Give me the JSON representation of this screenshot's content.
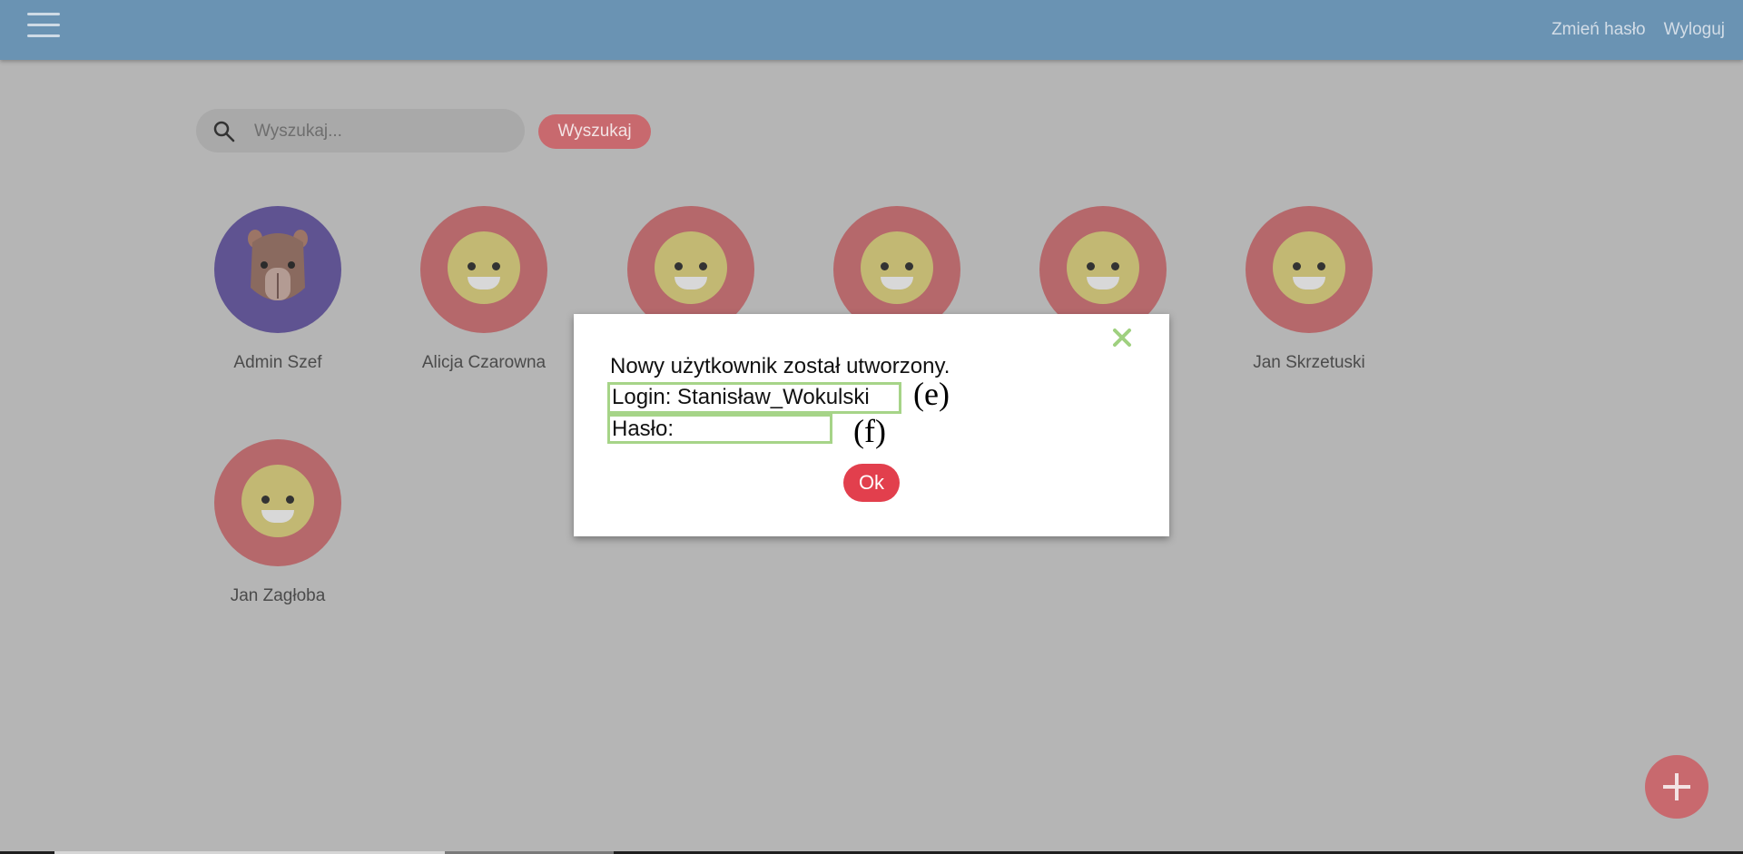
{
  "header": {
    "menu_icon": "hamburger-menu-icon",
    "links": [
      "Zmień hasło",
      "Wyloguj"
    ],
    "background": "#6a93b3"
  },
  "search": {
    "placeholder": "Wyszukaj...",
    "value": "",
    "button_label": "Wyszukaj",
    "icon": "search-icon"
  },
  "users": [
    {
      "name": "Admin Szef",
      "avatar": "capybara"
    },
    {
      "name": "Alicja Czarowna",
      "avatar": "smiley"
    },
    {
      "name": "",
      "avatar": "smiley"
    },
    {
      "name": "",
      "avatar": "smiley"
    },
    {
      "name": "",
      "avatar": "smiley"
    },
    {
      "name": "Jan Skrzetuski",
      "avatar": "smiley"
    },
    {
      "name": "Jan Zagłoba",
      "avatar": "smiley"
    }
  ],
  "modal": {
    "message": "Nowy użytkownik został utworzony.",
    "login_line": "Login: Stanisław_Wokulski",
    "password_line": "Hasło:",
    "ok_label": "Ok",
    "close_icon": "close-icon",
    "annotations": [
      "(e)",
      "(f)"
    ]
  },
  "fab": {
    "icon": "plus-icon"
  },
  "colors": {
    "accent": "#e23f4d",
    "overlay_gray": "#b5b5b5",
    "highlight_green": "#a6d488"
  }
}
